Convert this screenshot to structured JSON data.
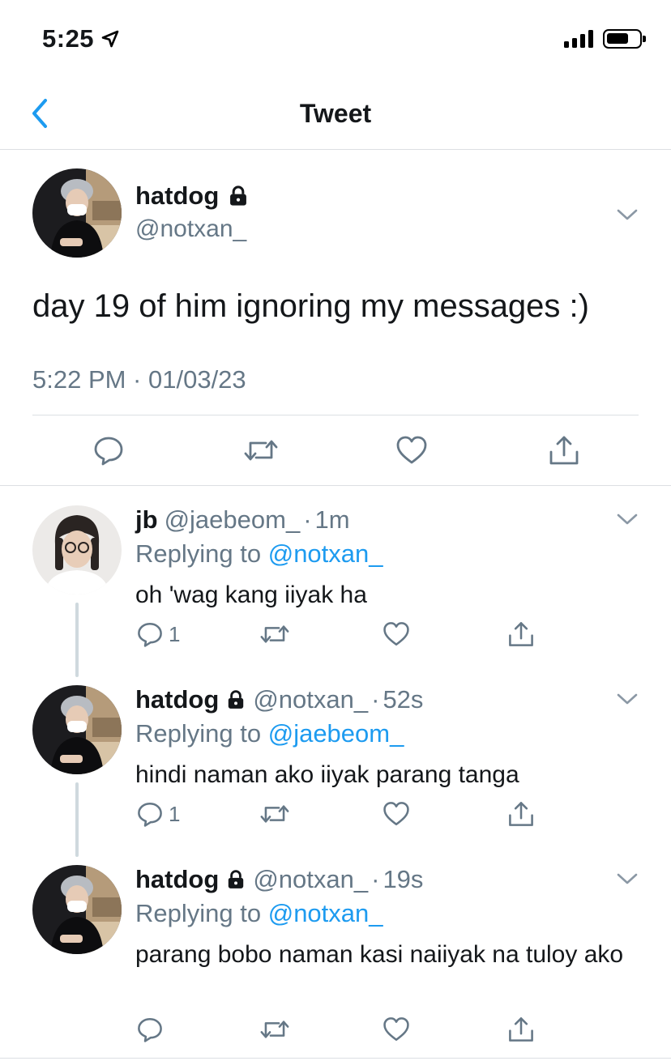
{
  "status_bar": {
    "time": "5:25"
  },
  "nav": {
    "title": "Tweet"
  },
  "main_tweet": {
    "name": "hatdog",
    "handle": "@notxan_",
    "text": "day 19 of him ignoring my messages :)",
    "timestamp": "5:22 PM · 01/03/23"
  },
  "replies": [
    {
      "name": "jb",
      "handle": "@jaebeom_",
      "separator": "·",
      "time": "1m",
      "replying_label": "Replying to",
      "replying_to": "@notxan_",
      "text": "oh 'wag kang iiyak ha",
      "reply_count": "1",
      "locked": false
    },
    {
      "name": "hatdog",
      "handle": "@notxan_",
      "separator": "·",
      "time": "52s",
      "replying_label": "Replying to",
      "replying_to": "@jaebeom_",
      "text": "hindi naman ako iiyak parang tanga",
      "reply_count": "1",
      "locked": true
    },
    {
      "name": "hatdog",
      "handle": "@notxan_",
      "separator": "·",
      "time": "19s",
      "replying_label": "Replying to",
      "replying_to": "@notxan_",
      "text": "parang bobo naman kasi naiiyak na tuloy ako",
      "reply_count": "",
      "locked": true
    }
  ],
  "icons": {
    "back": "chevron-left-icon",
    "lock": "lock-icon",
    "more": "chevron-down-icon",
    "reply": "comment-icon",
    "retweet": "retweet-icon",
    "like": "heart-icon",
    "share": "share-icon"
  },
  "colors": {
    "link": "#1d9bf0",
    "secondary_text": "#657786",
    "divider": "#dcdfe3",
    "icon": "#657786"
  }
}
